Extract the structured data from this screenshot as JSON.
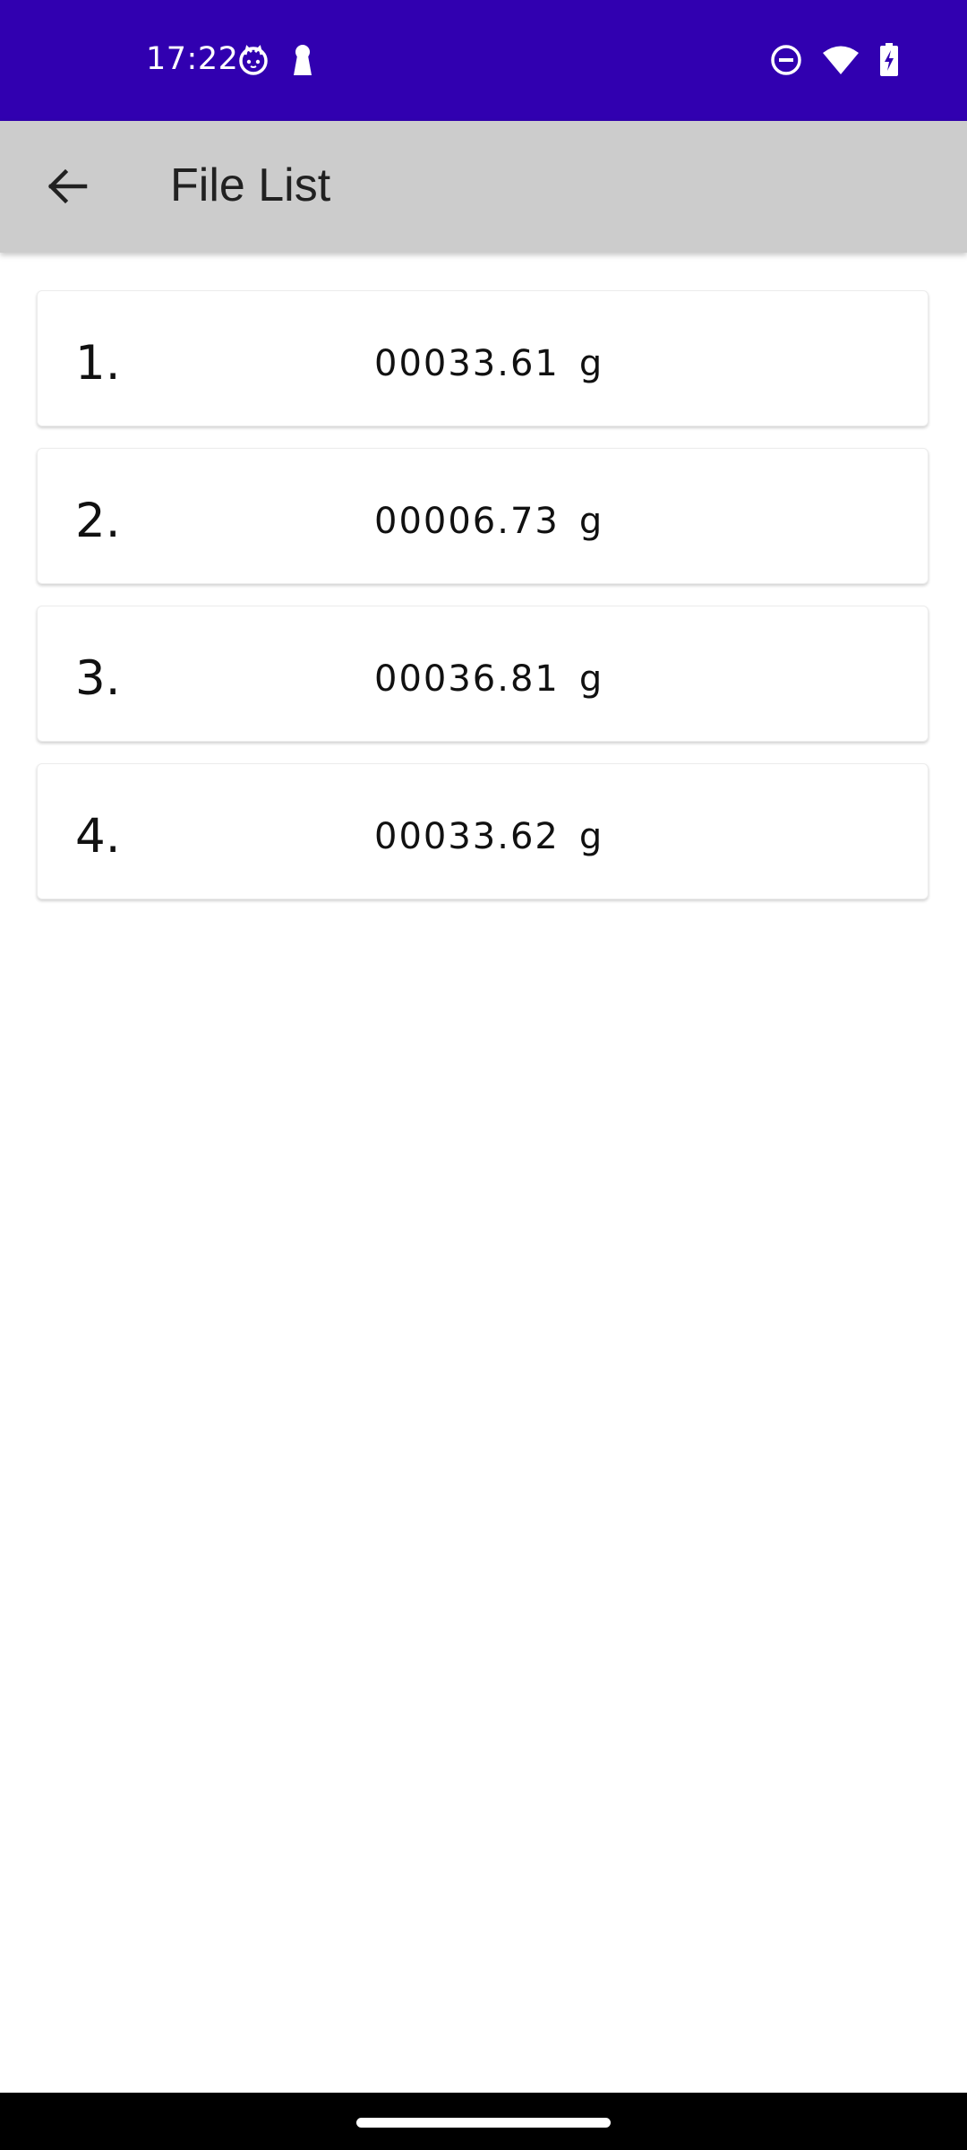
{
  "status_bar": {
    "time": "17:22",
    "background_color": "#3100b0",
    "left_icons": [
      "cat-face-icon",
      "keyhole-icon"
    ],
    "right_icons": [
      "do-not-disturb-icon",
      "wifi-icon",
      "battery-charging-icon"
    ]
  },
  "app_bar": {
    "title": "File List",
    "back_icon": "arrow-back-icon",
    "background_color": "#cccccc"
  },
  "files": [
    {
      "index": "1.",
      "value": "00033.61",
      "unit": "g"
    },
    {
      "index": "2.",
      "value": "00006.73",
      "unit": "g"
    },
    {
      "index": "3.",
      "value": "00036.81",
      "unit": "g"
    },
    {
      "index": "4.",
      "value": "00033.62",
      "unit": "g"
    }
  ]
}
